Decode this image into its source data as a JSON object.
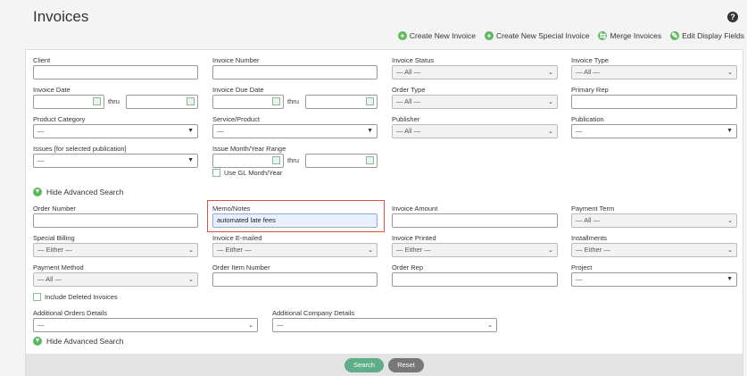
{
  "header": {
    "title": "Invoices",
    "help_glyph": "?",
    "actions": [
      {
        "label": "Create New Invoice",
        "icon": "plus-circle-icon",
        "glyph": "+"
      },
      {
        "label": "Create New Special Invoice",
        "icon": "plus-circle-icon",
        "glyph": "+"
      },
      {
        "label": "Merge Invoices",
        "icon": "merge-icon",
        "glyph": "⇆"
      },
      {
        "label": "Edit Display Fields",
        "icon": "pencil-icon",
        "glyph": "✎"
      }
    ]
  },
  "basic": {
    "client": {
      "label": "Client",
      "value": ""
    },
    "invoice_number": {
      "label": "Invoice Number",
      "value": ""
    },
    "invoice_status": {
      "label": "Invoice Status",
      "value": "— All —"
    },
    "invoice_type": {
      "label": "Invoice Type",
      "value": "— All —"
    },
    "invoice_date": {
      "label": "Invoice Date",
      "thru": "thru"
    },
    "invoice_due_date": {
      "label": "Invoice Due Date",
      "thru": "thru"
    },
    "order_type": {
      "label": "Order Type",
      "value": "— All —"
    },
    "primary_rep": {
      "label": "Primary Rep",
      "value": ""
    },
    "product_category": {
      "label": "Product Category",
      "value": "—"
    },
    "service_product": {
      "label": "Service/Product",
      "value": "—"
    },
    "publisher": {
      "label": "Publisher",
      "value": "— All —"
    },
    "publication": {
      "label": "Publication",
      "value": "—"
    },
    "issues": {
      "label": "Issues [for selected publication]",
      "value": "—"
    },
    "issue_month_year": {
      "label": "Issue Month/Year Range",
      "thru": "thru"
    },
    "use_gl": {
      "label": "Use GL Month/Year"
    }
  },
  "advanced": {
    "toggle_label": "Hide Advanced Search",
    "order_number": {
      "label": "Order Number",
      "value": ""
    },
    "memo_notes": {
      "label": "Memo/Notes",
      "value": "automated late fees"
    },
    "invoice_amount": {
      "label": "Invoice Amount",
      "value": ""
    },
    "payment_term": {
      "label": "Payment Term",
      "value": "— All —"
    },
    "special_billing": {
      "label": "Special Billing",
      "value": "— Either —"
    },
    "invoice_emailed": {
      "label": "Invoice E-mailed",
      "value": "— Either —"
    },
    "invoice_printed": {
      "label": "Invoice Printed",
      "value": "— Either —"
    },
    "installments": {
      "label": "Installments",
      "value": "— Either —"
    },
    "payment_method": {
      "label": "Payment Method",
      "value": "— All —"
    },
    "order_item_number": {
      "label": "Order Item Number",
      "value": ""
    },
    "order_rep": {
      "label": "Order Rep",
      "value": ""
    },
    "project": {
      "label": "Project",
      "value": "—"
    },
    "include_deleted": {
      "label": "Include Deleted Invoices"
    },
    "additional_orders": {
      "label": "Additional Orders Details",
      "value": "—"
    },
    "additional_company": {
      "label": "Additional Company Details",
      "value": "—"
    }
  },
  "footer": {
    "search_label": "Search",
    "reset_label": "Reset"
  },
  "colors": {
    "accent_green": "#5cb85c",
    "highlight_red": "#e0503c"
  }
}
